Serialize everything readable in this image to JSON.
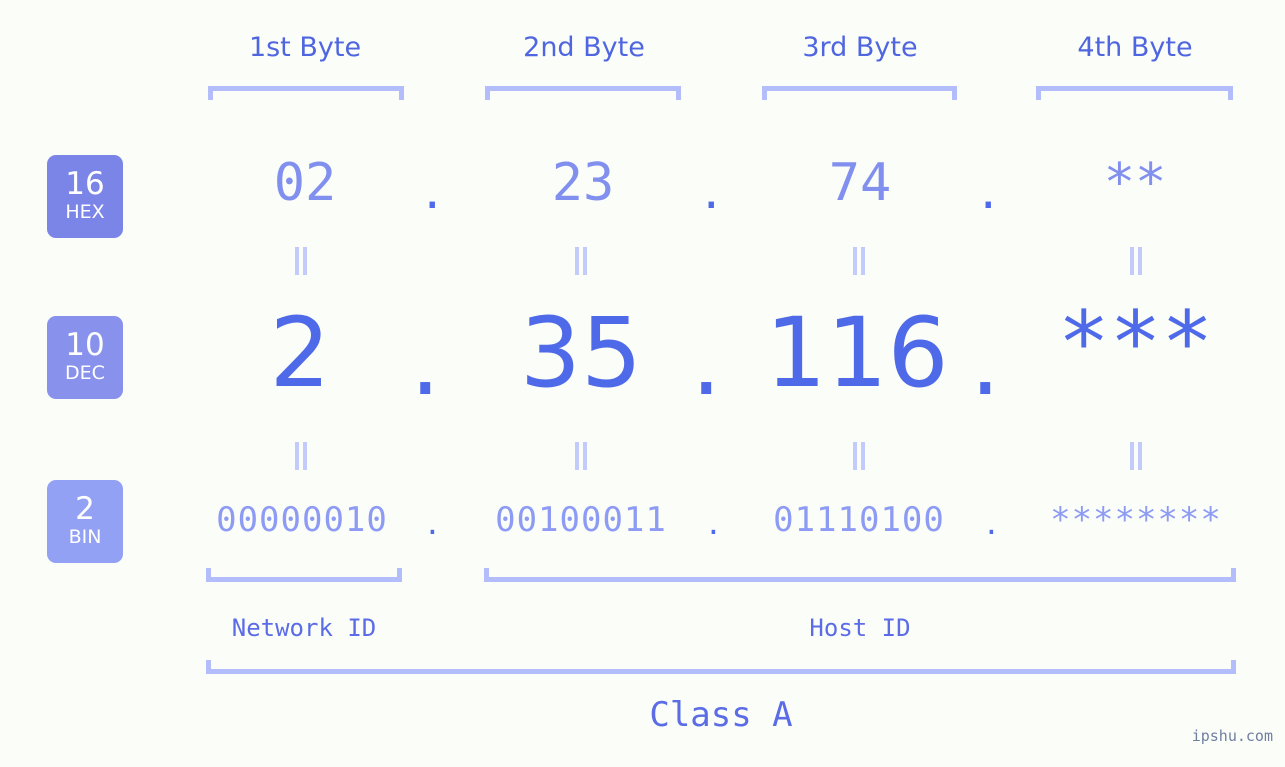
{
  "meta": {
    "watermark": "ipshu.com",
    "background_color": "#fbfdf8"
  },
  "colors": {
    "header_text": "#4f66e0",
    "bracket": "#b4bdfb",
    "hex_value": "#8190ee",
    "dec_value": "#4f6ae8",
    "bin_value": "#8d9bf4",
    "dot": "#4f6ae8",
    "eq_mark": "#c3cbfc",
    "badge_hex": "#7b85e8",
    "badge_dec": "#8891ec",
    "badge_bin": "#93a1f5",
    "section_label": "#5b6ce6"
  },
  "byte_headers": [
    {
      "label": "1st Byte"
    },
    {
      "label": "2nd Byte"
    },
    {
      "label": "3rd Byte"
    },
    {
      "label": "4th Byte"
    }
  ],
  "bases": [
    {
      "number": "16",
      "name": "HEX"
    },
    {
      "number": "10",
      "name": "DEC"
    },
    {
      "number": "2",
      "name": "BIN"
    }
  ],
  "rows": {
    "hex": {
      "base_number": "16",
      "base_name": "HEX",
      "values": [
        "02",
        "23",
        "74",
        "**"
      ],
      "separator": "."
    },
    "dec": {
      "base_number": "10",
      "base_name": "DEC",
      "values": [
        "2",
        "35",
        "116",
        "***"
      ],
      "separator": "."
    },
    "bin": {
      "base_number": "2",
      "base_name": "BIN",
      "values": [
        "00000010",
        "00100011",
        "01110100",
        "********"
      ],
      "separator": "."
    }
  },
  "equality_marks": {
    "glyph": "||",
    "count_per_row": 4
  },
  "sections": [
    {
      "label": "Network ID"
    },
    {
      "label": "Host ID"
    }
  ],
  "class": {
    "label": "Class A"
  }
}
